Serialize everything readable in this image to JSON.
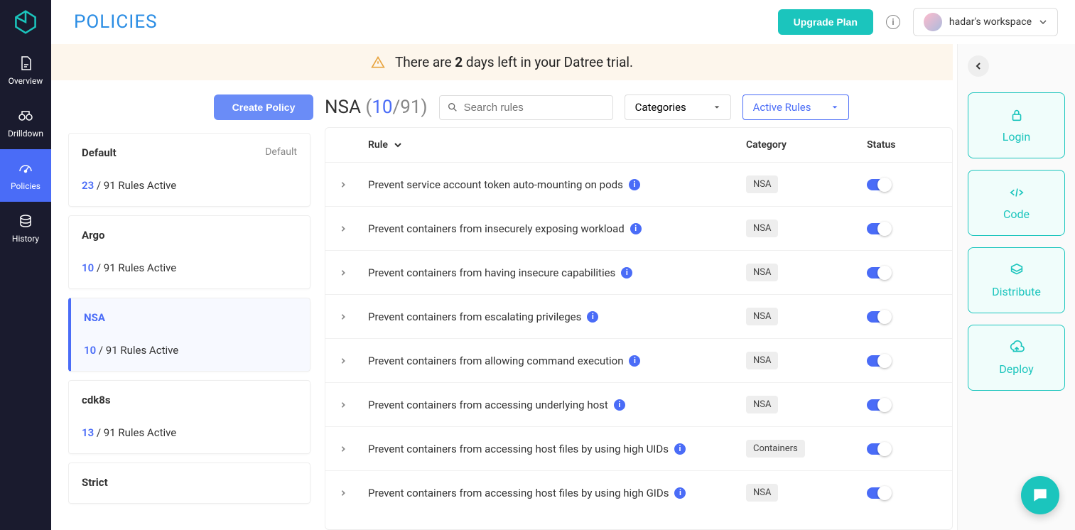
{
  "nav": {
    "items": [
      {
        "label": "Overview"
      },
      {
        "label": "Drilldown"
      },
      {
        "label": "Policies"
      },
      {
        "label": "History"
      }
    ]
  },
  "header": {
    "title": "POLICIES",
    "upgrade": "Upgrade Plan",
    "workspace": "hadar's workspace"
  },
  "banner": {
    "prefix": "There are ",
    "days": "2",
    "suffix": " days left in your Datree trial."
  },
  "createPolicy": "Create Policy",
  "policies": [
    {
      "name": "Default",
      "tag": "Default",
      "active": "23",
      "total": "91"
    },
    {
      "name": "Argo",
      "tag": "",
      "active": "10",
      "total": "91"
    },
    {
      "name": "NSA",
      "tag": "",
      "active": "10",
      "total": "91"
    },
    {
      "name": "cdk8s",
      "tag": "",
      "active": "13",
      "total": "91"
    },
    {
      "name": "Strict",
      "tag": "",
      "active": "",
      "total": ""
    }
  ],
  "rulesActiveSuffix": " Rules Active",
  "rulesArea": {
    "titleName": "NSA",
    "titleActive": "10",
    "titleTotal": "91",
    "searchPlaceholder": "Search rules",
    "categoriesLabel": "Categories",
    "activeRulesLabel": "Active Rules",
    "colRule": "Rule",
    "colCategory": "Category",
    "colStatus": "Status"
  },
  "rules": [
    {
      "name": "Prevent service account token auto-mounting on pods",
      "category": "NSA"
    },
    {
      "name": "Prevent containers from insecurely exposing workload",
      "category": "NSA"
    },
    {
      "name": "Prevent containers from having insecure capabilities",
      "category": "NSA"
    },
    {
      "name": "Prevent containers from escalating privileges",
      "category": "NSA"
    },
    {
      "name": "Prevent containers from allowing command execution",
      "category": "NSA"
    },
    {
      "name": "Prevent containers from accessing underlying host",
      "category": "NSA"
    },
    {
      "name": "Prevent containers from accessing host files by using high UIDs",
      "category": "Containers"
    },
    {
      "name": "Prevent containers from accessing host files by using high GIDs",
      "category": "NSA"
    }
  ],
  "steps": [
    {
      "label": "Login"
    },
    {
      "label": "Code"
    },
    {
      "label": "Distribute"
    },
    {
      "label": "Deploy"
    }
  ]
}
